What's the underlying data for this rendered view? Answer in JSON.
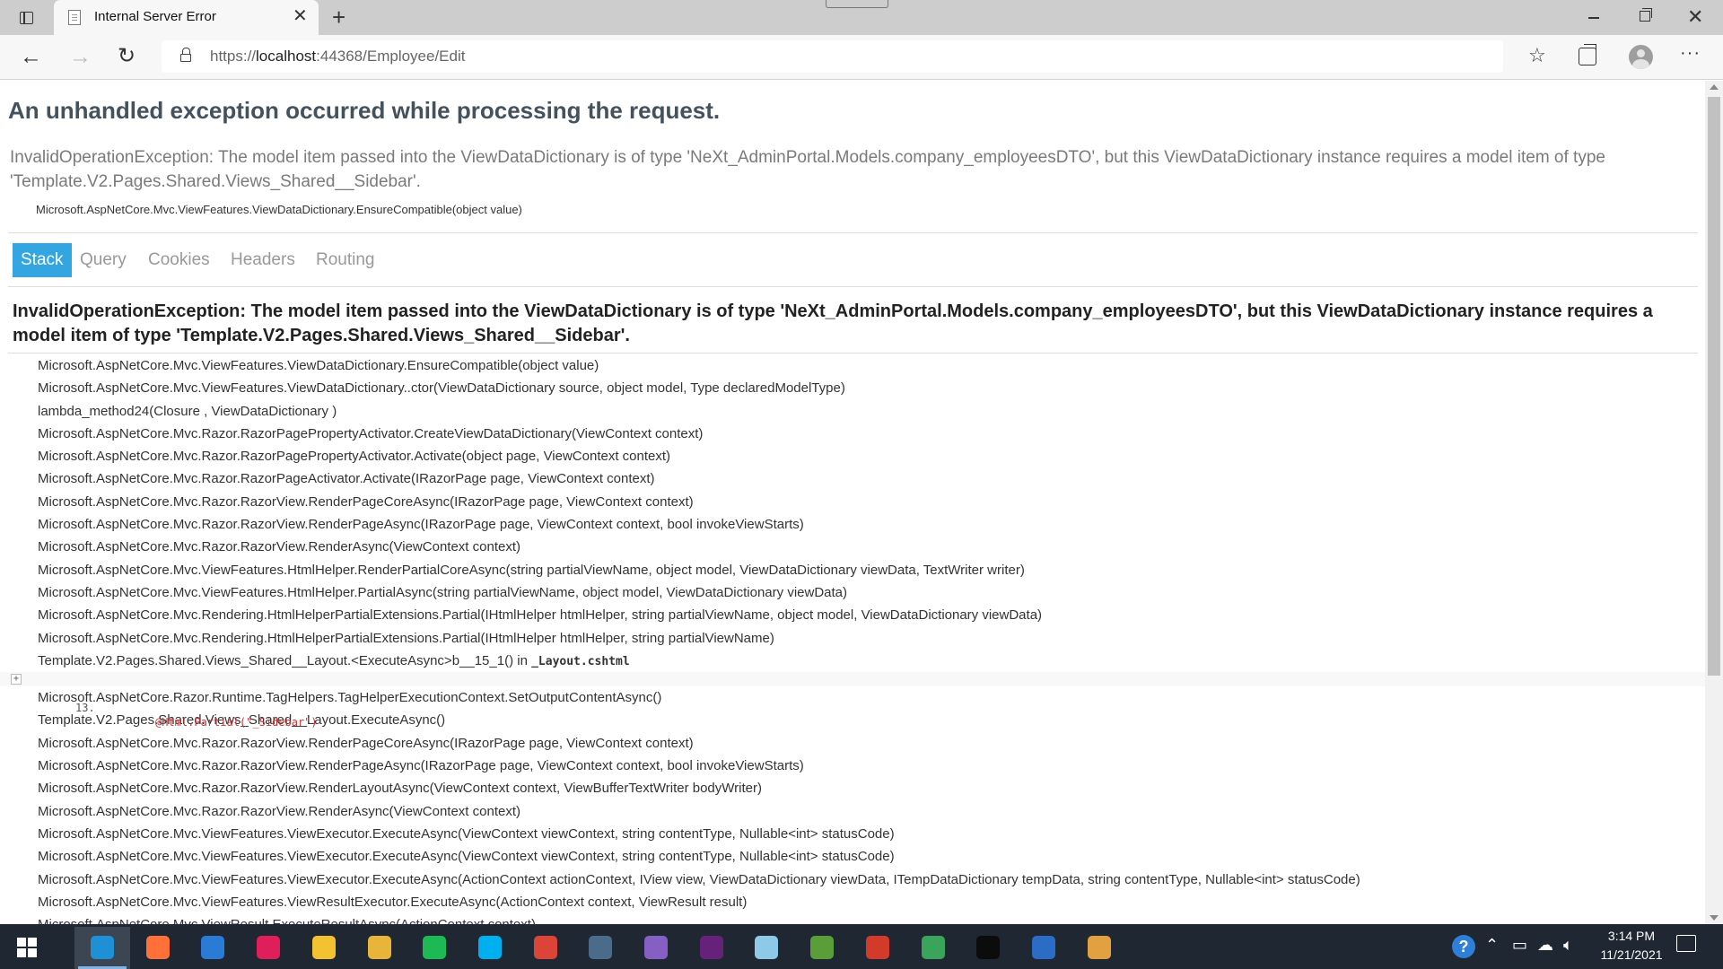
{
  "browser": {
    "tab_title": "Internal Server Error",
    "url_scheme": "https://",
    "url_host": "localhost",
    "url_rest": ":44368/Employee/Edit"
  },
  "page": {
    "title": "An unhandled exception occurred while processing the request.",
    "summary": "InvalidOperationException: The model item passed into the ViewDataDictionary is of type 'NeXt_AdminPortal.Models.company_employeesDTO', but this ViewDataDictionary instance requires a model item of type 'Template.V2.Pages.Shared.Views_Shared__Sidebar'.",
    "location": "Microsoft.AspNetCore.Mvc.ViewFeatures.ViewDataDictionary.EnsureCompatible(object value)",
    "tabs": [
      "Stack",
      "Query",
      "Cookies",
      "Headers",
      "Routing"
    ],
    "active_tab": "Stack",
    "exception_title": "InvalidOperationException: The model item passed into the ViewDataDictionary is of type 'NeXt_AdminPortal.Models.company_employeesDTO', but this ViewDataDictionary instance requires a model item of type 'Template.V2.Pages.Shared.Views_Shared__Sidebar'.",
    "frames_before": [
      "Microsoft.AspNetCore.Mvc.ViewFeatures.ViewDataDictionary.EnsureCompatible(object value)",
      "Microsoft.AspNetCore.Mvc.ViewFeatures.ViewDataDictionary..ctor(ViewDataDictionary source, object model, Type declaredModelType)",
      "lambda_method24(Closure , ViewDataDictionary )",
      "Microsoft.AspNetCore.Mvc.Razor.RazorPagePropertyActivator.CreateViewDataDictionary(ViewContext context)",
      "Microsoft.AspNetCore.Mvc.Razor.RazorPagePropertyActivator.Activate(object page, ViewContext context)",
      "Microsoft.AspNetCore.Mvc.Razor.RazorPageActivator.Activate(IRazorPage page, ViewContext context)",
      "Microsoft.AspNetCore.Mvc.Razor.RazorView.RenderPageCoreAsync(IRazorPage page, ViewContext context)",
      "Microsoft.AspNetCore.Mvc.Razor.RazorView.RenderPageAsync(IRazorPage page, ViewContext context, bool invokeViewStarts)",
      "Microsoft.AspNetCore.Mvc.Razor.RazorView.RenderAsync(ViewContext context)",
      "Microsoft.AspNetCore.Mvc.ViewFeatures.HtmlHelper.RenderPartialCoreAsync(string partialViewName, object model, ViewDataDictionary viewData, TextWriter writer)",
      "Microsoft.AspNetCore.Mvc.ViewFeatures.HtmlHelper.PartialAsync(string partialViewName, object model, ViewDataDictionary viewData)",
      "Microsoft.AspNetCore.Mvc.Rendering.HtmlHelperPartialExtensions.Partial(IHtmlHelper htmlHelper, string partialViewName, object model, ViewDataDictionary viewData)",
      "Microsoft.AspNetCore.Mvc.Rendering.HtmlHelperPartialExtensions.Partial(IHtmlHelper htmlHelper, string partialViewName)"
    ],
    "source_frame": {
      "method": "Template.V2.Pages.Shared.Views_Shared__Layout.<ExecuteAsync>b__15_1() in ",
      "file": "_Layout.cshtml",
      "expand": "+",
      "line_number": "13.",
      "code": "@Html.Partial(\"_Sidebar\")"
    },
    "frames_after": [
      "Microsoft.AspNetCore.Razor.Runtime.TagHelpers.TagHelperExecutionContext.SetOutputContentAsync()",
      "Template.V2.Pages.Shared.Views_Shared__Layout.ExecuteAsync()",
      "Microsoft.AspNetCore.Mvc.Razor.RazorView.RenderPageCoreAsync(IRazorPage page, ViewContext context)",
      "Microsoft.AspNetCore.Mvc.Razor.RazorView.RenderPageAsync(IRazorPage page, ViewContext context, bool invokeViewStarts)",
      "Microsoft.AspNetCore.Mvc.Razor.RazorView.RenderLayoutAsync(ViewContext context, ViewBufferTextWriter bodyWriter)",
      "Microsoft.AspNetCore.Mvc.Razor.RazorView.RenderAsync(ViewContext context)",
      "Microsoft.AspNetCore.Mvc.ViewFeatures.ViewExecutor.ExecuteAsync(ViewContext viewContext, string contentType, Nullable<int> statusCode)",
      "Microsoft.AspNetCore.Mvc.ViewFeatures.ViewExecutor.ExecuteAsync(ViewContext viewContext, string contentType, Nullable<int> statusCode)",
      "Microsoft.AspNetCore.Mvc.ViewFeatures.ViewExecutor.ExecuteAsync(ActionContext actionContext, IView view, ViewDataDictionary viewData, ITempDataDictionary tempData, string contentType, Nullable<int> statusCode)",
      "Microsoft.AspNetCore.Mvc.ViewFeatures.ViewResultExecutor.ExecuteAsync(ActionContext context, ViewResult result)",
      "Microsoft.AspNetCore.Mvc.ViewResult.ExecuteResultAsync(ActionContext context)"
    ]
  },
  "taskbar": {
    "apps": [
      {
        "name": "edge-app",
        "color": "#1f8fd6",
        "active": true
      },
      {
        "name": "firefox-app",
        "color": "#ff7139"
      },
      {
        "name": "mail-app",
        "color": "#2a7bd5"
      },
      {
        "name": "slack-app",
        "color": "#e01e5a"
      },
      {
        "name": "file-explorer-app",
        "color": "#f2c230"
      },
      {
        "name": "outlook-folder-app",
        "color": "#e8b43a"
      },
      {
        "name": "spotify-app",
        "color": "#1db954"
      },
      {
        "name": "skype-app",
        "color": "#00aff0"
      },
      {
        "name": "chrome-app",
        "color": "#db4437"
      },
      {
        "name": "network-tool-app",
        "color": "#4a6b8a"
      },
      {
        "name": "visual-studio-app",
        "color": "#865fc5"
      },
      {
        "name": "visual-studio-2-app",
        "color": "#68217a"
      },
      {
        "name": "notepad-app",
        "color": "#8fc9e8"
      },
      {
        "name": "spreadsheet-app",
        "color": "#5a9e3a"
      },
      {
        "name": "remote-app",
        "color": "#d23b2a"
      },
      {
        "name": "vpn-app",
        "color": "#3aa55a"
      },
      {
        "name": "terminal-app",
        "color": "#0c0c0c"
      },
      {
        "name": "computer-app",
        "color": "#2b6cc4"
      },
      {
        "name": "paint-app",
        "color": "#e2a040"
      }
    ],
    "help_label": "?",
    "time": "3:14 PM",
    "date": "11/21/2021"
  }
}
